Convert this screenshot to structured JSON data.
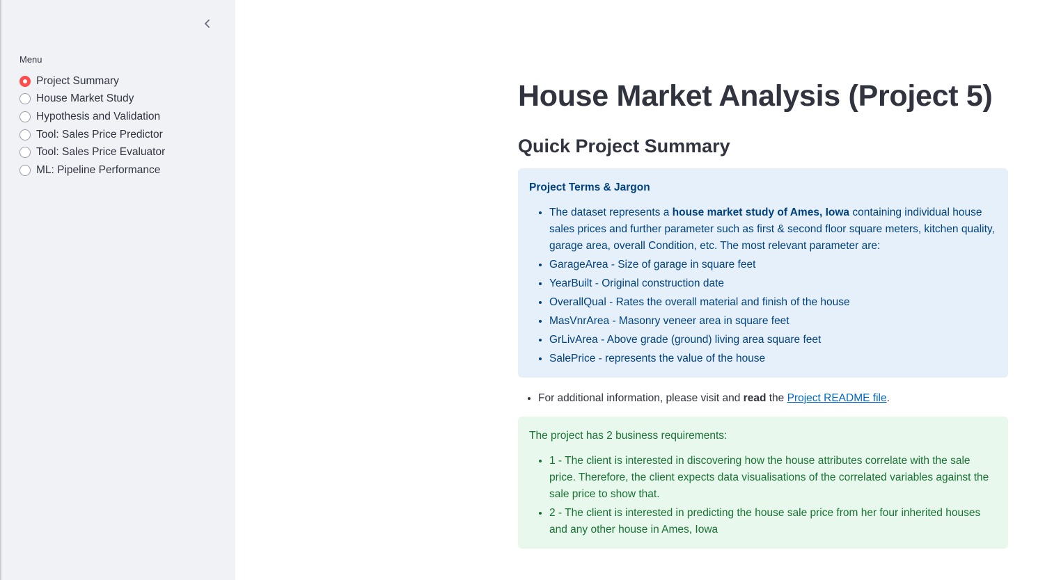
{
  "sidebar": {
    "collapse_icon": "chevron-left-icon",
    "menu_label": "Menu",
    "items": [
      {
        "label": "Project Summary",
        "selected": true
      },
      {
        "label": "House Market Study",
        "selected": false
      },
      {
        "label": "Hypothesis and Validation",
        "selected": false
      },
      {
        "label": "Tool: Sales Price Predictor",
        "selected": false
      },
      {
        "label": "Tool: Sales Price Evaluator",
        "selected": false
      },
      {
        "label": "ML: Pipeline Performance",
        "selected": false
      }
    ]
  },
  "main": {
    "title": "House Market Analysis (Project 5)",
    "subtitle": "Quick Project Summary",
    "info_box": {
      "heading": "Project Terms & Jargon",
      "intro_pre": "The dataset represents a ",
      "intro_bold": "house market study of Ames, Iowa",
      "intro_post": " containing individual house sales prices and further parameter such as first & second floor square meters, kitchen quality, garage area, overall Condition, etc. The most relevant parameter are:",
      "terms": [
        "GarageArea - Size of garage in square feet",
        "YearBuilt - Original construction date",
        "OverallQual - Rates the overall material and finish of the house",
        "MasVnrArea - Masonry veneer area in square feet",
        "GrLivArea - Above grade (ground) living area square feet",
        "SalePrice - represents the value of the house"
      ]
    },
    "readme": {
      "pre": "For additional information, please visit and ",
      "bold": "read",
      "mid": " the ",
      "link": "Project README file",
      "post": "."
    },
    "requirements_box": {
      "heading": "The project has 2 business requirements:",
      "items": [
        "1 - The client is interested in discovering how the house attributes correlate with the sale price. Therefore, the client expects data visualisations of the correlated variables against the sale price to show that.",
        "2 - The client is interested in predicting the house sale price from her four inherited houses and any other house in Ames, Iowa"
      ]
    }
  },
  "colors": {
    "sidebar_bg": "#f0f2f6",
    "accent": "#ff4b4b",
    "info_bg": "#e6f0fb",
    "info_text": "#004280",
    "success_bg": "#e8f8ec",
    "success_text": "#177233",
    "link": "#0068c9"
  }
}
